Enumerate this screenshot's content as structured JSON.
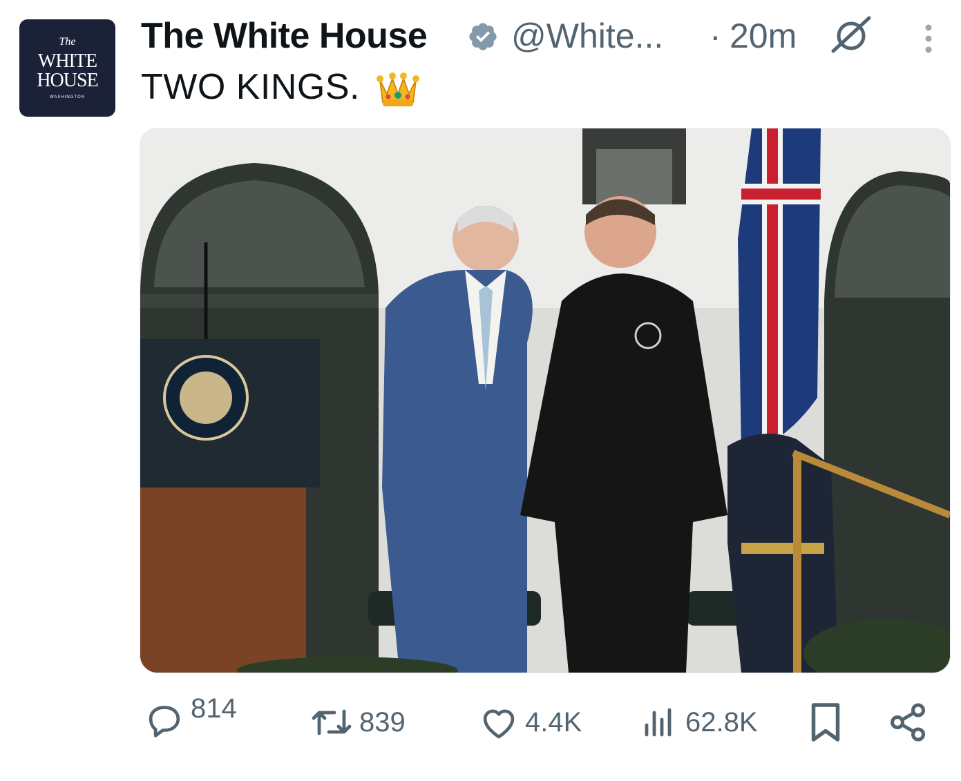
{
  "account": {
    "avatar_the": "The",
    "avatar_line1": "WHITE",
    "avatar_line2": "HOUSE",
    "avatar_line3": "WASHINGTON",
    "display_name": "The White House",
    "handle": "@White...",
    "separator": "·",
    "time": "20m"
  },
  "tweet": {
    "text": "TWO KINGS.",
    "emoji": "crown"
  },
  "photo": {
    "description_icon": "photo"
  },
  "actions": {
    "replies": "814",
    "reposts": "839",
    "likes": "4.4K",
    "views": "62.8K"
  },
  "colors": {
    "text_primary": "#0f1419",
    "text_secondary": "#536471",
    "avatar_bg": "#1b2238"
  },
  "icons": [
    "verified-badge-icon",
    "grok-icon",
    "more-icon",
    "reply-icon",
    "repost-icon",
    "like-icon",
    "views-icon",
    "bookmark-icon",
    "share-icon"
  ]
}
